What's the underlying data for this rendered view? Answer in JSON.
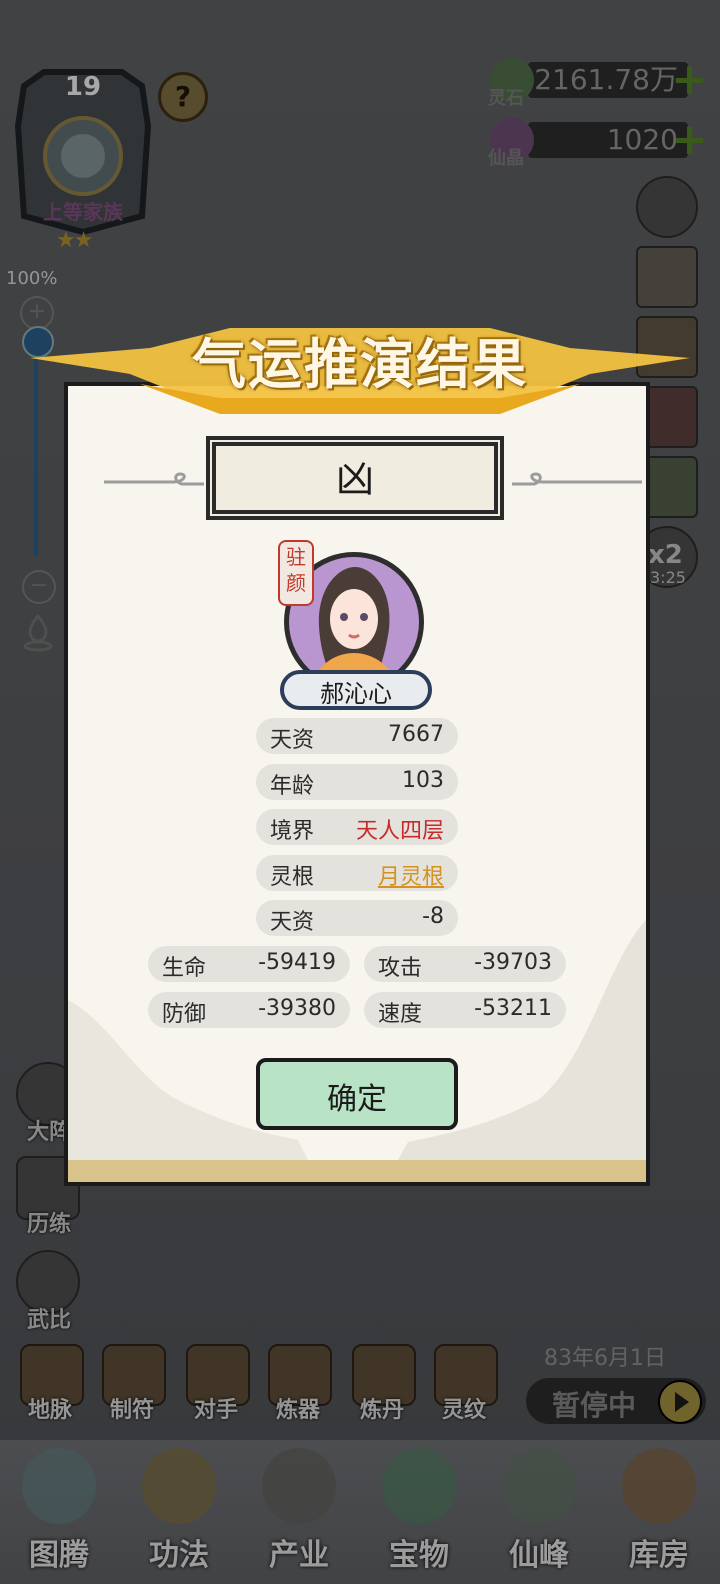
{
  "header": {
    "level": "19",
    "help_glyph": "?",
    "family_rank": "上等家族",
    "stars": "★★"
  },
  "zoom": {
    "percent": "100%",
    "plus": "+",
    "minus": "−",
    "level": 1.0
  },
  "resources": [
    {
      "name": "灵石",
      "value": "2161.78万",
      "plus": "+"
    },
    {
      "name": "仙晶",
      "value": "1020",
      "plus": "+"
    }
  ],
  "left_side": [
    {
      "label": "大阵"
    },
    {
      "label": "历练"
    },
    {
      "label": "武比"
    }
  ],
  "right_side_extra": {
    "multiplier": "x2",
    "timer": "3:25"
  },
  "functions": [
    {
      "label": "地脉"
    },
    {
      "label": "制符"
    },
    {
      "label": "对手"
    },
    {
      "label": "炼器"
    },
    {
      "label": "炼丹"
    },
    {
      "label": "灵纹"
    }
  ],
  "status": {
    "date": "83年6月1日",
    "pause_label": "暂停中"
  },
  "bottom_nav": [
    {
      "label": "图腾"
    },
    {
      "label": "功法"
    },
    {
      "label": "产业"
    },
    {
      "label": "宝物"
    },
    {
      "label": "仙峰"
    },
    {
      "label": "库房"
    }
  ],
  "modal": {
    "title": "气运推演结果",
    "result": "凶",
    "seal_text": "驻颜",
    "character_name": "郝沁心",
    "stats": [
      {
        "label": "天资",
        "value": "7667"
      },
      {
        "label": "年龄",
        "value": "103"
      },
      {
        "label": "境界",
        "value": "天人四层"
      },
      {
        "label": "灵根",
        "value": "月灵根"
      },
      {
        "label": "天资",
        "value": "-8"
      }
    ],
    "attributes": [
      {
        "label": "生命",
        "value": "-59419"
      },
      {
        "label": "攻击",
        "value": "-39703"
      },
      {
        "label": "防御",
        "value": "-39380"
      },
      {
        "label": "速度",
        "value": "-53211"
      }
    ],
    "confirm_label": "确定"
  },
  "colors": {
    "realm_text": "#c72a2a",
    "root_text": "#d5921f",
    "confirm_bg": "#b8e4c5",
    "plus_green": "#4f7d22"
  }
}
